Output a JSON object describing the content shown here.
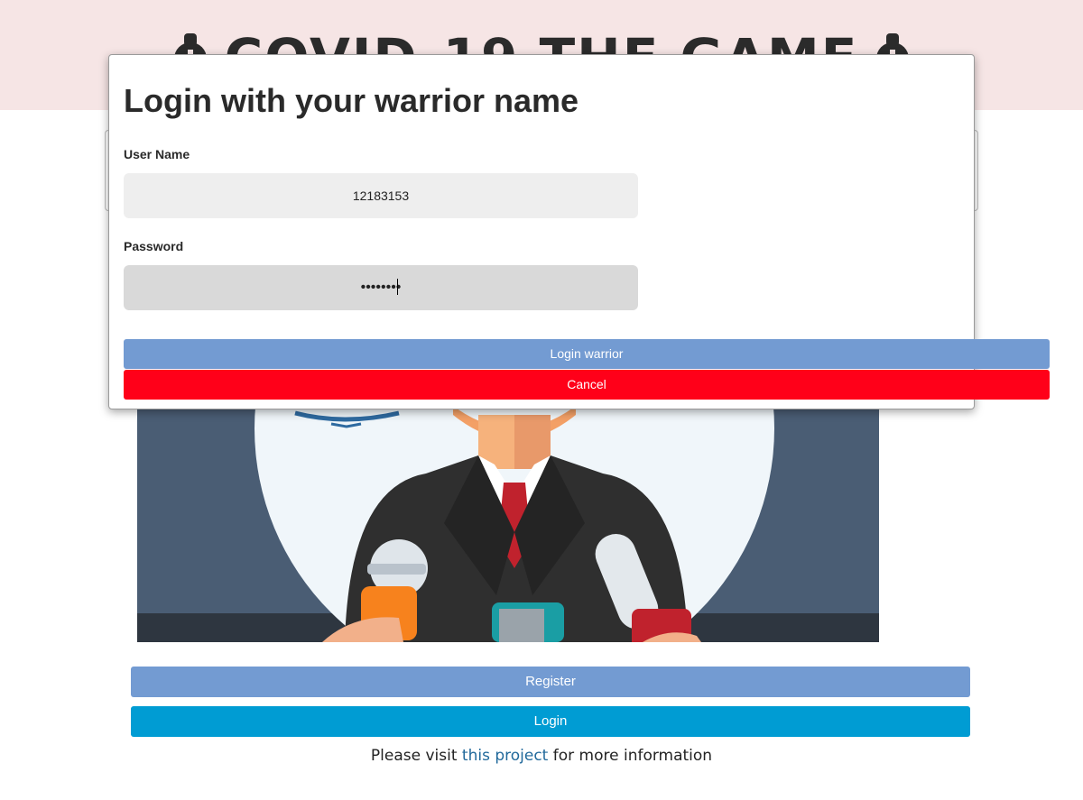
{
  "header": {
    "title": "COVID-19 THE GAME",
    "left_icon": "medal-icon",
    "right_icon": "medal-icon",
    "background": "#f6e5e5"
  },
  "hero": {
    "image": "press-conference-speaker-illustration"
  },
  "buttons": {
    "register_label": "Register",
    "login_label": "Login"
  },
  "footer": {
    "prefix": "Please visit ",
    "link_text": "this project",
    "suffix": " for more information"
  },
  "modal": {
    "title": "Login with your warrior name",
    "username_label": "User Name",
    "username_value": "12183153",
    "password_label": "Password",
    "password_value": "••••••••",
    "login_button": "Login warrior",
    "cancel_button": "Cancel"
  },
  "colors": {
    "primary": "#739bd2",
    "login": "#009cd3",
    "cancel": "#ff0019",
    "link": "#21699b"
  }
}
